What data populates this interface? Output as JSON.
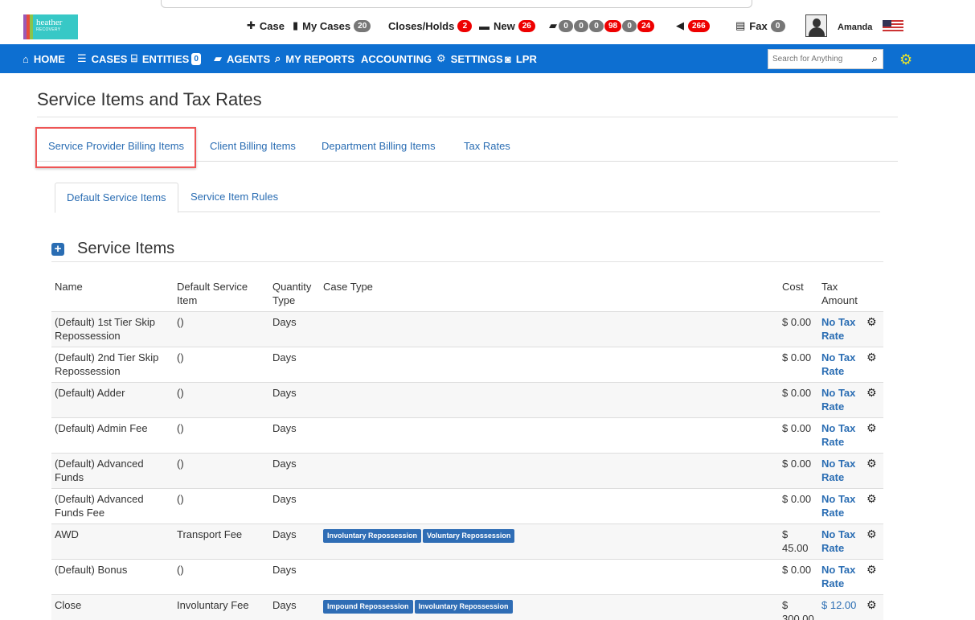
{
  "header": {
    "logo_text": "heather",
    "logo_sub": "RECOVERY",
    "case_label": "Case",
    "mycases_label": "My Cases",
    "mycases_count": "20",
    "closes_label": "Closes/Holds",
    "closes_count": "2",
    "new_label": "New",
    "new_count": "26",
    "truck_counts": [
      "0",
      "0",
      "0",
      "98",
      "0",
      "24"
    ],
    "announce_count": "266",
    "fax_label": "Fax",
    "fax_count": "0",
    "username": "Amanda"
  },
  "nav": {
    "home": "HOME",
    "cases": "CASES",
    "entities": "ENTITIES",
    "entities_count": "0",
    "agents": "AGENTS",
    "reports": "MY REPORTS",
    "accounting": "ACCOUNTING",
    "settings": "SETTINGS",
    "lpr": "LPR",
    "search_placeholder": "Search for Anything"
  },
  "page": {
    "title": "Service Items and Tax Rates",
    "tabs": [
      "Service Provider Billing Items",
      "Client Billing Items",
      "Department Billing Items",
      "Tax Rates"
    ],
    "subtabs": [
      "Default Service Items",
      "Service Item Rules"
    ],
    "section_title": "Service Items"
  },
  "table": {
    "headers": {
      "name": "Name",
      "default_item_1": "Default Service",
      "default_item_2": "Item",
      "qty_1": "Quantity",
      "qty_2": "Type",
      "case_type": "Case Type",
      "cost": "Cost",
      "tax_1": "Tax",
      "tax_2": "Amount"
    },
    "rows": [
      {
        "name": "(Default) 1st Tier Skip Repossession",
        "default_item": "()",
        "qty": "Days",
        "tags": [],
        "cost": "$ 0.00",
        "tax": "No Tax Rate"
      },
      {
        "name": "(Default) 2nd Tier Skip Repossession",
        "default_item": "()",
        "qty": "Days",
        "tags": [],
        "cost": "$ 0.00",
        "tax": "No Tax Rate"
      },
      {
        "name": "(Default) Adder",
        "default_item": "()",
        "qty": "Days",
        "tags": [],
        "cost": "$ 0.00",
        "tax": "No Tax Rate"
      },
      {
        "name": "(Default) Admin Fee",
        "default_item": "()",
        "qty": "Days",
        "tags": [],
        "cost": "$ 0.00",
        "tax": "No Tax Rate"
      },
      {
        "name": "(Default) Advanced Funds",
        "default_item": "()",
        "qty": "Days",
        "tags": [],
        "cost": "$ 0.00",
        "tax": "No Tax Rate"
      },
      {
        "name": "(Default) Advanced Funds Fee",
        "default_item": "()",
        "qty": "Days",
        "tags": [],
        "cost": "$ 0.00",
        "tax": "No Tax Rate"
      },
      {
        "name": "AWD",
        "default_item": "Transport Fee",
        "qty": "Days",
        "tags": [
          "Involuntary Repossession",
          "Voluntary Repossession"
        ],
        "cost": "$ 45.00",
        "tax": "No Tax Rate"
      },
      {
        "name": "(Default) Bonus",
        "default_item": "()",
        "qty": "Days",
        "tags": [],
        "cost": "$ 0.00",
        "tax": "No Tax Rate"
      },
      {
        "name": "Close",
        "default_item": "Involuntary Fee",
        "qty": "Days",
        "tags": [
          "Impound Repossession",
          "Involuntary Repossession"
        ],
        "cost": "$ 300.00",
        "tax": "$ 12.00"
      }
    ]
  }
}
